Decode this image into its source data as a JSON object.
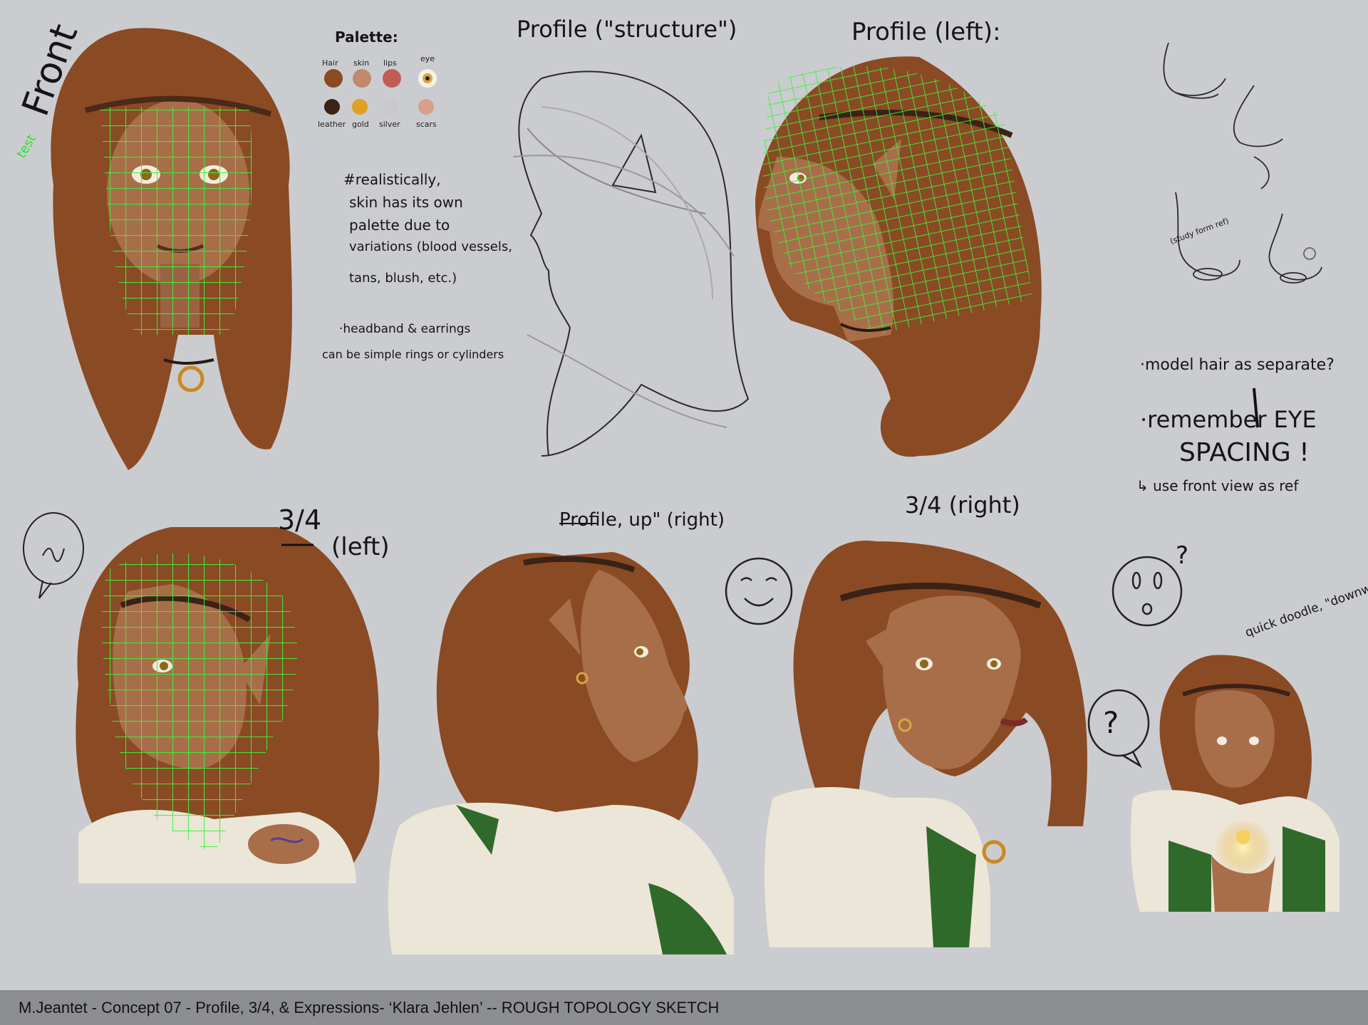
{
  "labels": {
    "front": "Front",
    "test": "test",
    "palette_title": "Palette:",
    "profile_structure": "Profile (\"structure\")",
    "profile_left": "Profile (left):",
    "three_quarter_left_a": "3/4",
    "three_quarter_left_b": "(left)",
    "profile_up_right": "Profile, up\" (right)",
    "three_quarter_right": "3/4 (right)",
    "quick_doodle": "quick doodle, \"downwards\"",
    "study_form": "(study form ref)"
  },
  "palette": {
    "swatches_row1": [
      {
        "label": "Hair",
        "color": "#8a4a24"
      },
      {
        "label": "skin",
        "color": "#c08a6a"
      },
      {
        "label": "lips",
        "color": "#c25c55"
      },
      {
        "label": "eye",
        "color": "#d9a640"
      }
    ],
    "swatches_row2": [
      {
        "label": "leather",
        "color": "#3b2116"
      },
      {
        "label": "gold",
        "color": "#e0a020"
      },
      {
        "label": "silver",
        "color": "#c9c9cb"
      },
      {
        "label": "scars",
        "color": "#d6a08a"
      }
    ]
  },
  "notes": {
    "skin_1": "#realistically,",
    "skin_2": "skin has its own",
    "skin_3": "palette due to",
    "skin_4": "variations (blood vessels,",
    "skin_5": "tans, blush, etc.)",
    "head_1": "·headband & earrings",
    "head_2": "can be simple rings or cylinders",
    "hair_note": "·model hair as separate?",
    "eye_1": "·remember EYE",
    "eye_2": "SPACING !",
    "eye_3": "↳ use front view as ref"
  },
  "footer": {
    "caption": "M.Jeantet - Concept 07 - Profile, 3/4, & Expressions- ‘Klara Jehlen’  -- ROUGH TOPOLOGY SKETCH"
  },
  "colors": {
    "background": "#cbcccf",
    "hair": "#8a4a24",
    "skin": "#a86e4a",
    "wireframe": "#3cf23c",
    "blouse": "#ece6d8",
    "vest": "#2f6a2a",
    "footer_bar": "#8d8e91"
  }
}
